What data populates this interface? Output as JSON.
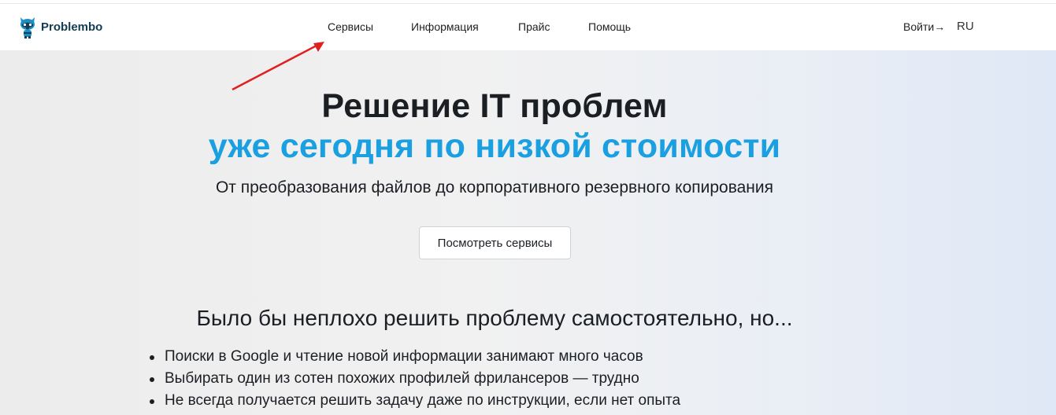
{
  "header": {
    "brand": "Problembo",
    "nav": [
      {
        "label": "Сервисы"
      },
      {
        "label": "Информация"
      },
      {
        "label": "Прайс"
      },
      {
        "label": "Помощь"
      }
    ],
    "login_label": "Войти",
    "login_icon": "arrow-right-icon",
    "lang_label": "RU"
  },
  "hero": {
    "title_line1": "Решение IT проблем",
    "title_line2": "уже сегодня по низкой стоимости",
    "subtitle": "От преобразования файлов до корпоративного резервного копирования",
    "cta_label": "Посмотреть сервисы",
    "accent_color": "#1aa0e0"
  },
  "problems": {
    "heading": "Было бы неплохо решить проблему самостоятельно, но...",
    "items": [
      "Поиски в Google и чтение новой информации занимают много часов",
      "Выбирать один из сотен похожих профилей фрилансеров — трудно",
      "Не всегда получается решить задачу даже по инструкции, если нет опыта"
    ]
  },
  "annotation": {
    "arrow_color": "#e02020",
    "arrow_target": "Сервисы"
  }
}
